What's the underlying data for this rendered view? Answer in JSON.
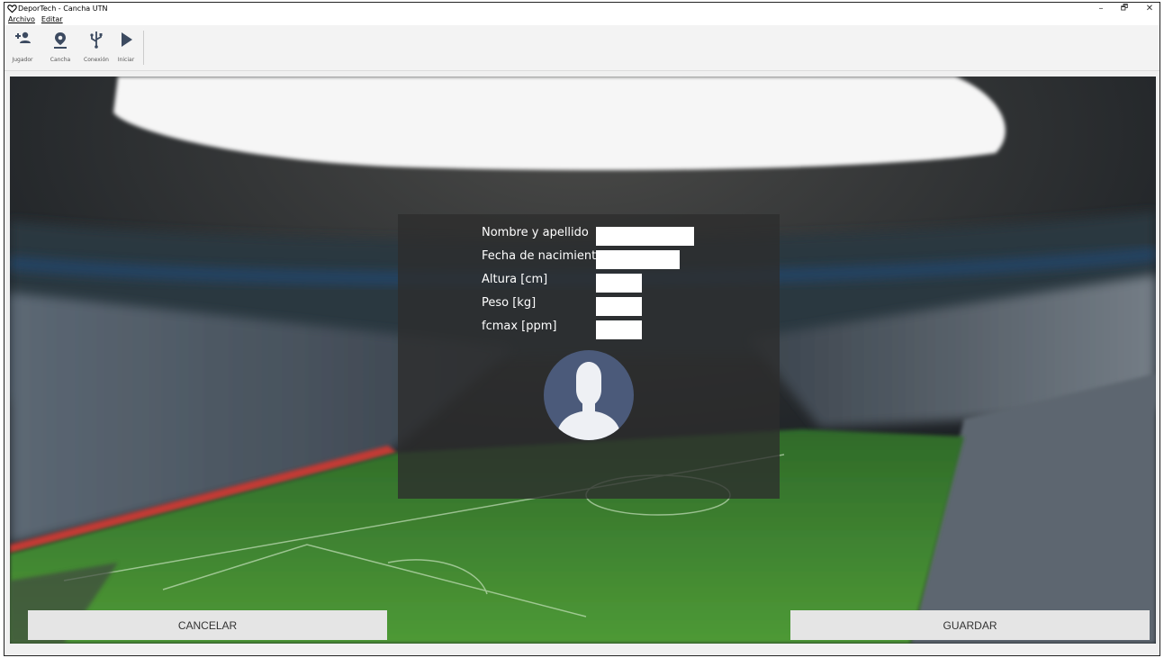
{
  "window": {
    "title": "DeporTech - Cancha UTN",
    "controls": [
      "–",
      "🗗",
      "✕"
    ]
  },
  "menu": {
    "archivo": "Archivo",
    "editar": "Editar"
  },
  "toolbar": {
    "buttons": [
      {
        "label": "Jugador",
        "icon": "add-user-icon"
      },
      {
        "label": "Cancha",
        "icon": "map-pin-icon"
      },
      {
        "label": "Conexión",
        "icon": "usb-icon"
      },
      {
        "label": "Iniciar",
        "icon": "play-icon"
      }
    ]
  },
  "form": {
    "fields": [
      {
        "label": "Nombre y apellido",
        "value": ""
      },
      {
        "label": "Fecha de nacimiento",
        "value": ""
      },
      {
        "label": "Altura [cm]",
        "value": ""
      },
      {
        "label": "Peso [kg]",
        "value": ""
      },
      {
        "label": "fcmax [ppm]",
        "value": ""
      }
    ],
    "avatar_icon": "user-avatar-icon"
  },
  "actions": {
    "cancel": "CANCELAR",
    "save": "GUARDAR"
  },
  "colors": {
    "panel": "#2d2d2d",
    "avatar_bg": "#4b5a7a",
    "avatar_fg": "#eef0f4",
    "button_bg": "#e5e5e5"
  }
}
